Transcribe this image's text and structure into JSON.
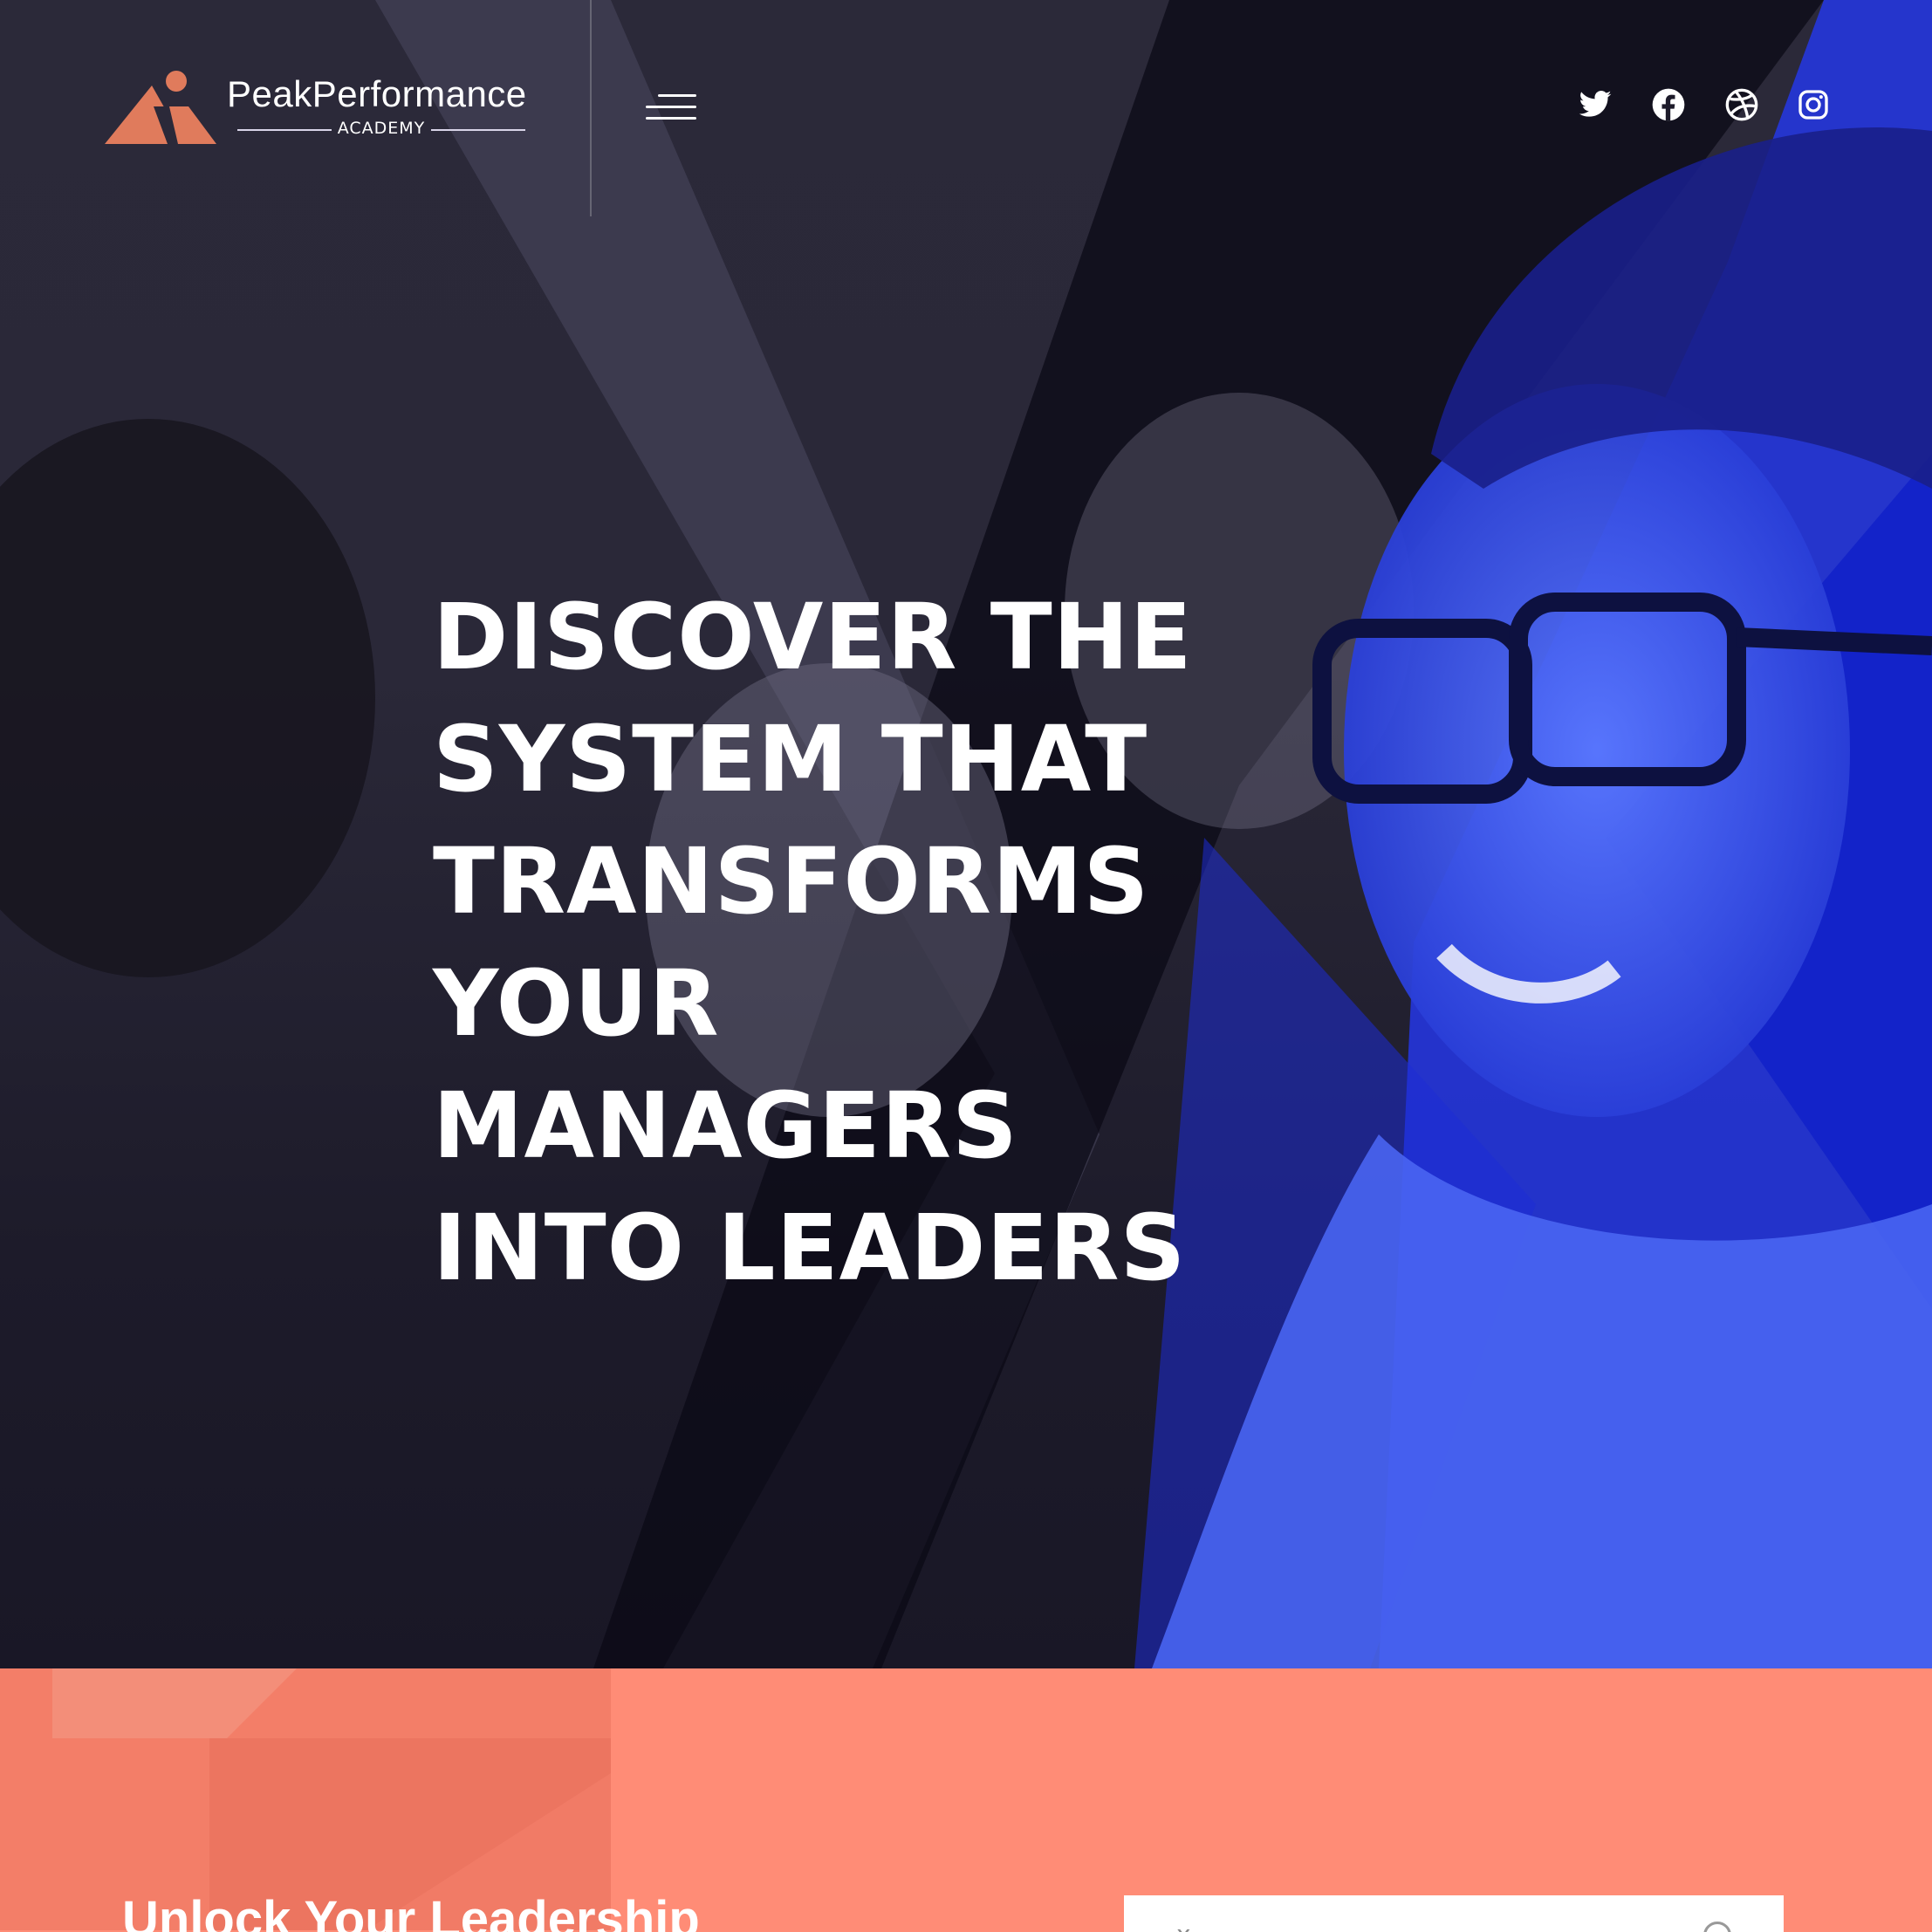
{
  "brand": {
    "name": "PeakPerformance",
    "subtitle": "ACADEMY",
    "logo_icon": "peak-mountain-logo",
    "logo_color": "#e07b5c"
  },
  "nav": {
    "menu_icon": "hamburger-menu-icon"
  },
  "social": [
    {
      "name": "twitter",
      "icon": "twitter-icon"
    },
    {
      "name": "facebook",
      "icon": "facebook-icon"
    },
    {
      "name": "dribbble",
      "icon": "dribbble-icon"
    },
    {
      "name": "instagram",
      "icon": "instagram-icon"
    }
  ],
  "hero": {
    "headline_lines": [
      "DISCOVER THE",
      "SYSTEM THAT",
      "TRANSFORMS",
      "YOUR",
      "MANAGERS",
      "INTO LEADERS"
    ],
    "accent_blue": "#2d3ff0",
    "overlay_dark": "#2a2838"
  },
  "promo": {
    "title": "Unlock Your Leadership",
    "background_color": "#ff8c76",
    "form_close_glyph": "x"
  }
}
